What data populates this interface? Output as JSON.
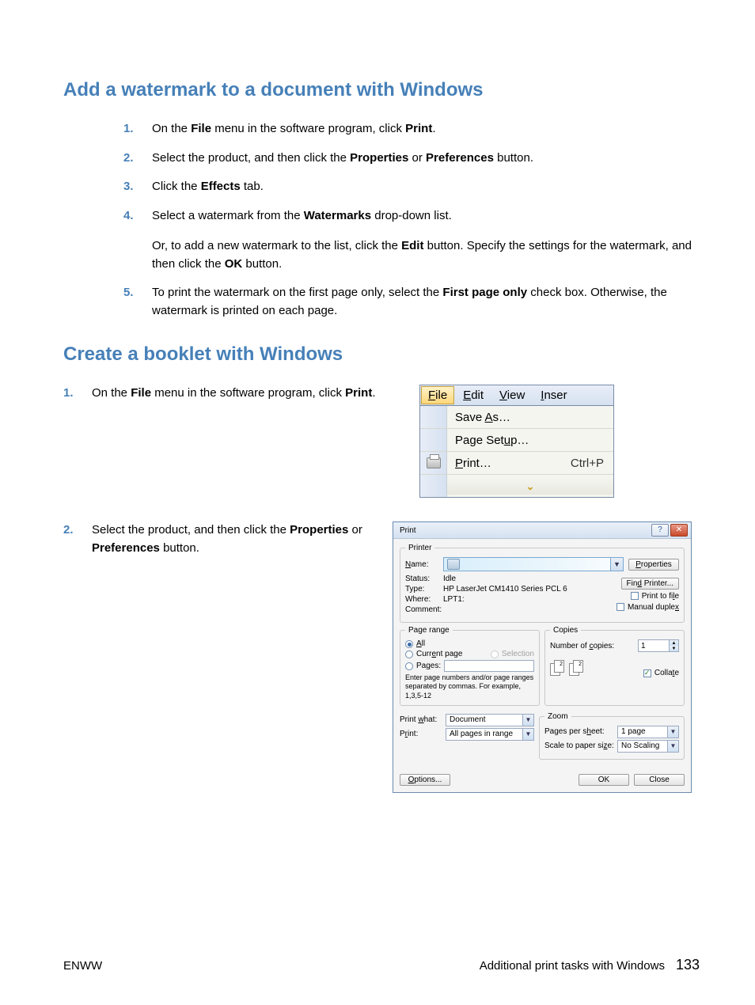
{
  "section1": {
    "heading": "Add a watermark to a document with Windows",
    "steps": [
      {
        "num": "1.",
        "parts": [
          {
            "t": "On the "
          },
          {
            "t": "File",
            "b": true
          },
          {
            "t": " menu in the software program, click "
          },
          {
            "t": "Print",
            "b": true
          },
          {
            "t": "."
          }
        ]
      },
      {
        "num": "2.",
        "parts": [
          {
            "t": "Select the product, and then click the "
          },
          {
            "t": "Properties",
            "b": true
          },
          {
            "t": " or "
          },
          {
            "t": "Preferences",
            "b": true
          },
          {
            "t": " button."
          }
        ]
      },
      {
        "num": "3.",
        "parts": [
          {
            "t": "Click the "
          },
          {
            "t": "Effects",
            "b": true
          },
          {
            "t": " tab."
          }
        ]
      },
      {
        "num": "4.",
        "paragraphs": [
          [
            {
              "t": "Select a watermark from the "
            },
            {
              "t": "Watermarks",
              "b": true
            },
            {
              "t": " drop-down list."
            }
          ],
          [
            {
              "t": "Or, to add a new watermark to the list, click the "
            },
            {
              "t": "Edit",
              "b": true
            },
            {
              "t": " button. Specify the settings for the watermark, and then click the "
            },
            {
              "t": "OK",
              "b": true
            },
            {
              "t": " button."
            }
          ]
        ]
      },
      {
        "num": "5.",
        "parts": [
          {
            "t": "To print the watermark on the first page only, select the "
          },
          {
            "t": "First page only",
            "b": true
          },
          {
            "t": " check box. Otherwise, the watermark is printed on each page."
          }
        ]
      }
    ]
  },
  "section2": {
    "heading": "Create a booklet with Windows",
    "step1": {
      "num": "1.",
      "parts": [
        {
          "t": "On the "
        },
        {
          "t": "File",
          "b": true
        },
        {
          "t": " menu in the software program, click "
        },
        {
          "t": "Print",
          "b": true
        },
        {
          "t": "."
        }
      ]
    },
    "step2": {
      "num": "2.",
      "parts": [
        {
          "t": "Select the product, and then click the "
        },
        {
          "t": "Properties",
          "b": true
        },
        {
          "t": " or "
        },
        {
          "t": "Preferences",
          "b": true
        },
        {
          "t": " button."
        }
      ]
    }
  },
  "menu": {
    "bar": {
      "file": "File",
      "edit": "Edit",
      "view": "View",
      "insert": "Inser"
    },
    "items": {
      "saveas": "Save As…",
      "pagesetup": "Page Setup…",
      "print": "Print…",
      "print_shortcut": "Ctrl+P"
    }
  },
  "dialog": {
    "title": "Print",
    "printer": {
      "legend": "Printer",
      "name_lbl": "Name:",
      "status_lbl": "Status:",
      "status": "Idle",
      "type_lbl": "Type:",
      "type": "HP LaserJet CM1410 Series PCL 6",
      "where_lbl": "Where:",
      "where": "LPT1:",
      "comment_lbl": "Comment:",
      "properties_btn": "Properties",
      "find_btn": "Find Printer...",
      "print_to_file": "Print to file",
      "manual_duplex": "Manual duplex"
    },
    "range": {
      "legend": "Page range",
      "all": "All",
      "current": "Current page",
      "selection": "Selection",
      "pages": "Pages:",
      "hint": "Enter page numbers and/or page ranges separated by commas. For example, 1,3,5-12"
    },
    "copies": {
      "legend": "Copies",
      "num_lbl": "Number of copies:",
      "num": "1",
      "collate": "Collate"
    },
    "bottomleft": {
      "printwhat_lbl": "Print what:",
      "printwhat": "Document",
      "print_lbl": "Print:",
      "print": "All pages in range"
    },
    "zoom": {
      "legend": "Zoom",
      "pps_lbl": "Pages per sheet:",
      "pps": "1 page",
      "scale_lbl": "Scale to paper size:",
      "scale": "No Scaling"
    },
    "options_btn": "Options...",
    "ok_btn": "OK",
    "close_btn": "Close"
  },
  "footer": {
    "left": "ENWW",
    "right": "Additional print tasks with Windows",
    "page": "133"
  }
}
